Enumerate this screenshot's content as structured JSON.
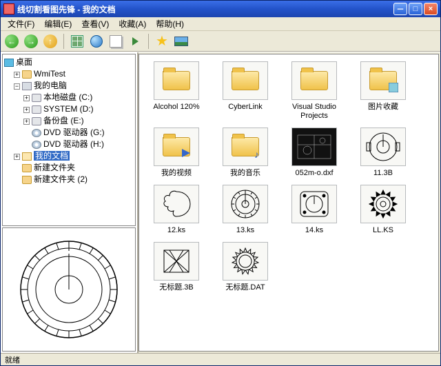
{
  "window": {
    "title": "线切割看图先锋  -  我的文档"
  },
  "menu": {
    "file": "文件(F)",
    "edit": "编辑(E)",
    "view": "查看(V)",
    "fav": "收藏(A)",
    "help": "帮助(H)"
  },
  "toolbar": {
    "back": "←",
    "fwd": "→",
    "up": "↑"
  },
  "tree": {
    "root": "桌面",
    "n1": "WmiTest",
    "n2": "我的电脑",
    "n2a": "本地磁盘 (C:)",
    "n2b": "SYSTEM (D:)",
    "n2c": "备份盘 (E:)",
    "n2d": "DVD 驱动器 (G:)",
    "n2e": "DVD 驱动器 (H:)",
    "n3": "我的文档",
    "n4": "新建文件夹",
    "n5": "新建文件夹 (2)"
  },
  "items": {
    "i0": "Alcohol 120%",
    "i1": "CyberLink",
    "i2": "Visual Studio Projects",
    "i3": "图片收藏",
    "i4": "我的视频",
    "i5": "我的音乐",
    "i6": "052m-o.dxf",
    "i7": "11.3B",
    "i8": "12.ks",
    "i9": "13.ks",
    "i10": "14.ks",
    "i11": "LL.KS",
    "i12": "无标题.3B",
    "i13": "无标题.DAT"
  },
  "status": "就绪"
}
